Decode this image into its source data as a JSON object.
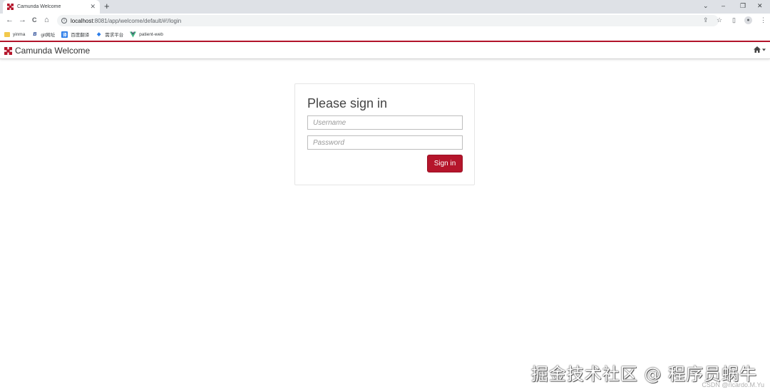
{
  "browser": {
    "tab": {
      "title": "Camunda Welcome",
      "close": "✕"
    },
    "new_tab": "+",
    "window_controls": {
      "list": "⌄",
      "minimize": "–",
      "restore": "❐",
      "close": "✕"
    },
    "nav": {
      "back": "←",
      "forward": "→",
      "reload": "C",
      "home": "⌂"
    },
    "url": {
      "host": "localhost",
      "path": ":8081/app/welcome/default/#!/login"
    },
    "bookmarks": [
      {
        "label": "yinma",
        "icon": "folder-icon"
      },
      {
        "label": "git网址",
        "icon": "b-icon"
      },
      {
        "label": "百度翻译",
        "icon": "translate-icon"
      },
      {
        "label": "需求平台",
        "icon": "diamond-icon"
      },
      {
        "label": "patient-web",
        "icon": "vue-icon"
      }
    ]
  },
  "app": {
    "brand": "Camunda Welcome",
    "accent": "#b5152b"
  },
  "login": {
    "title": "Please sign in",
    "username_placeholder": "Username",
    "password_placeholder": "Password",
    "username_value": "",
    "password_value": "",
    "submit_label": "Sign in"
  },
  "watermark": {
    "main": "掘金技术社区 @ 程序员蜗牛",
    "sub": "CSDN @ricardo.M.Yu"
  }
}
